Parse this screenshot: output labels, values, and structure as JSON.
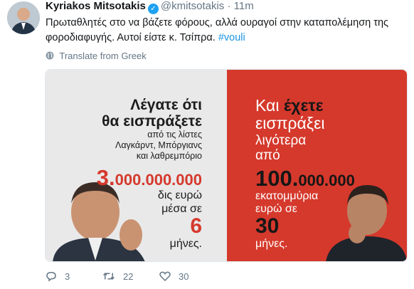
{
  "tweet": {
    "author_name": "Kyriakos Mitsotakis",
    "handle": "@kmitsotakis",
    "separator": "·",
    "time": "11m",
    "text_main": "Πρωταθλητές στο να βάζετε φόρους, αλλά ουραγοί στην καταπολέμηση της φοροδιαφυγής. Αυτοί είστε κ. Τσίπρα.",
    "hashtag": "#vouli",
    "translate_label": "Translate from Greek"
  },
  "image": {
    "left": {
      "line1": "Λέγατε ότι",
      "line2": "θα εισπράξετε",
      "line3": "από τις λίστες",
      "line4": "Λαγκάρντ, Μπόργιανς",
      "line5": "και λαθρεμπόριο",
      "amount_big": "3.",
      "amount_rest": "000.000.000",
      "unit1": "δις ευρώ",
      "unit2": "μέσα σε",
      "months_num": "6",
      "months_word": "μήνες."
    },
    "right": {
      "kai": "Και",
      "exete": "έχετε",
      "eisprakei": "εισπράξει",
      "ligotera": "λιγότερα",
      "apo": "από",
      "amount_big": "100.",
      "amount_rest": "000.000",
      "unit1": "εκατομμύρια",
      "unit2": "ευρώ σε",
      "months_num": "30",
      "months_word": "μήνες."
    },
    "colors": {
      "left_bg": "#e9e9ea",
      "right_bg": "#d5392c"
    }
  },
  "actions": {
    "replies": "3",
    "retweets": "22",
    "likes": "30"
  },
  "icons": [
    "verified-badge-icon",
    "globe-icon",
    "reply-icon",
    "retweet-icon",
    "like-icon"
  ]
}
